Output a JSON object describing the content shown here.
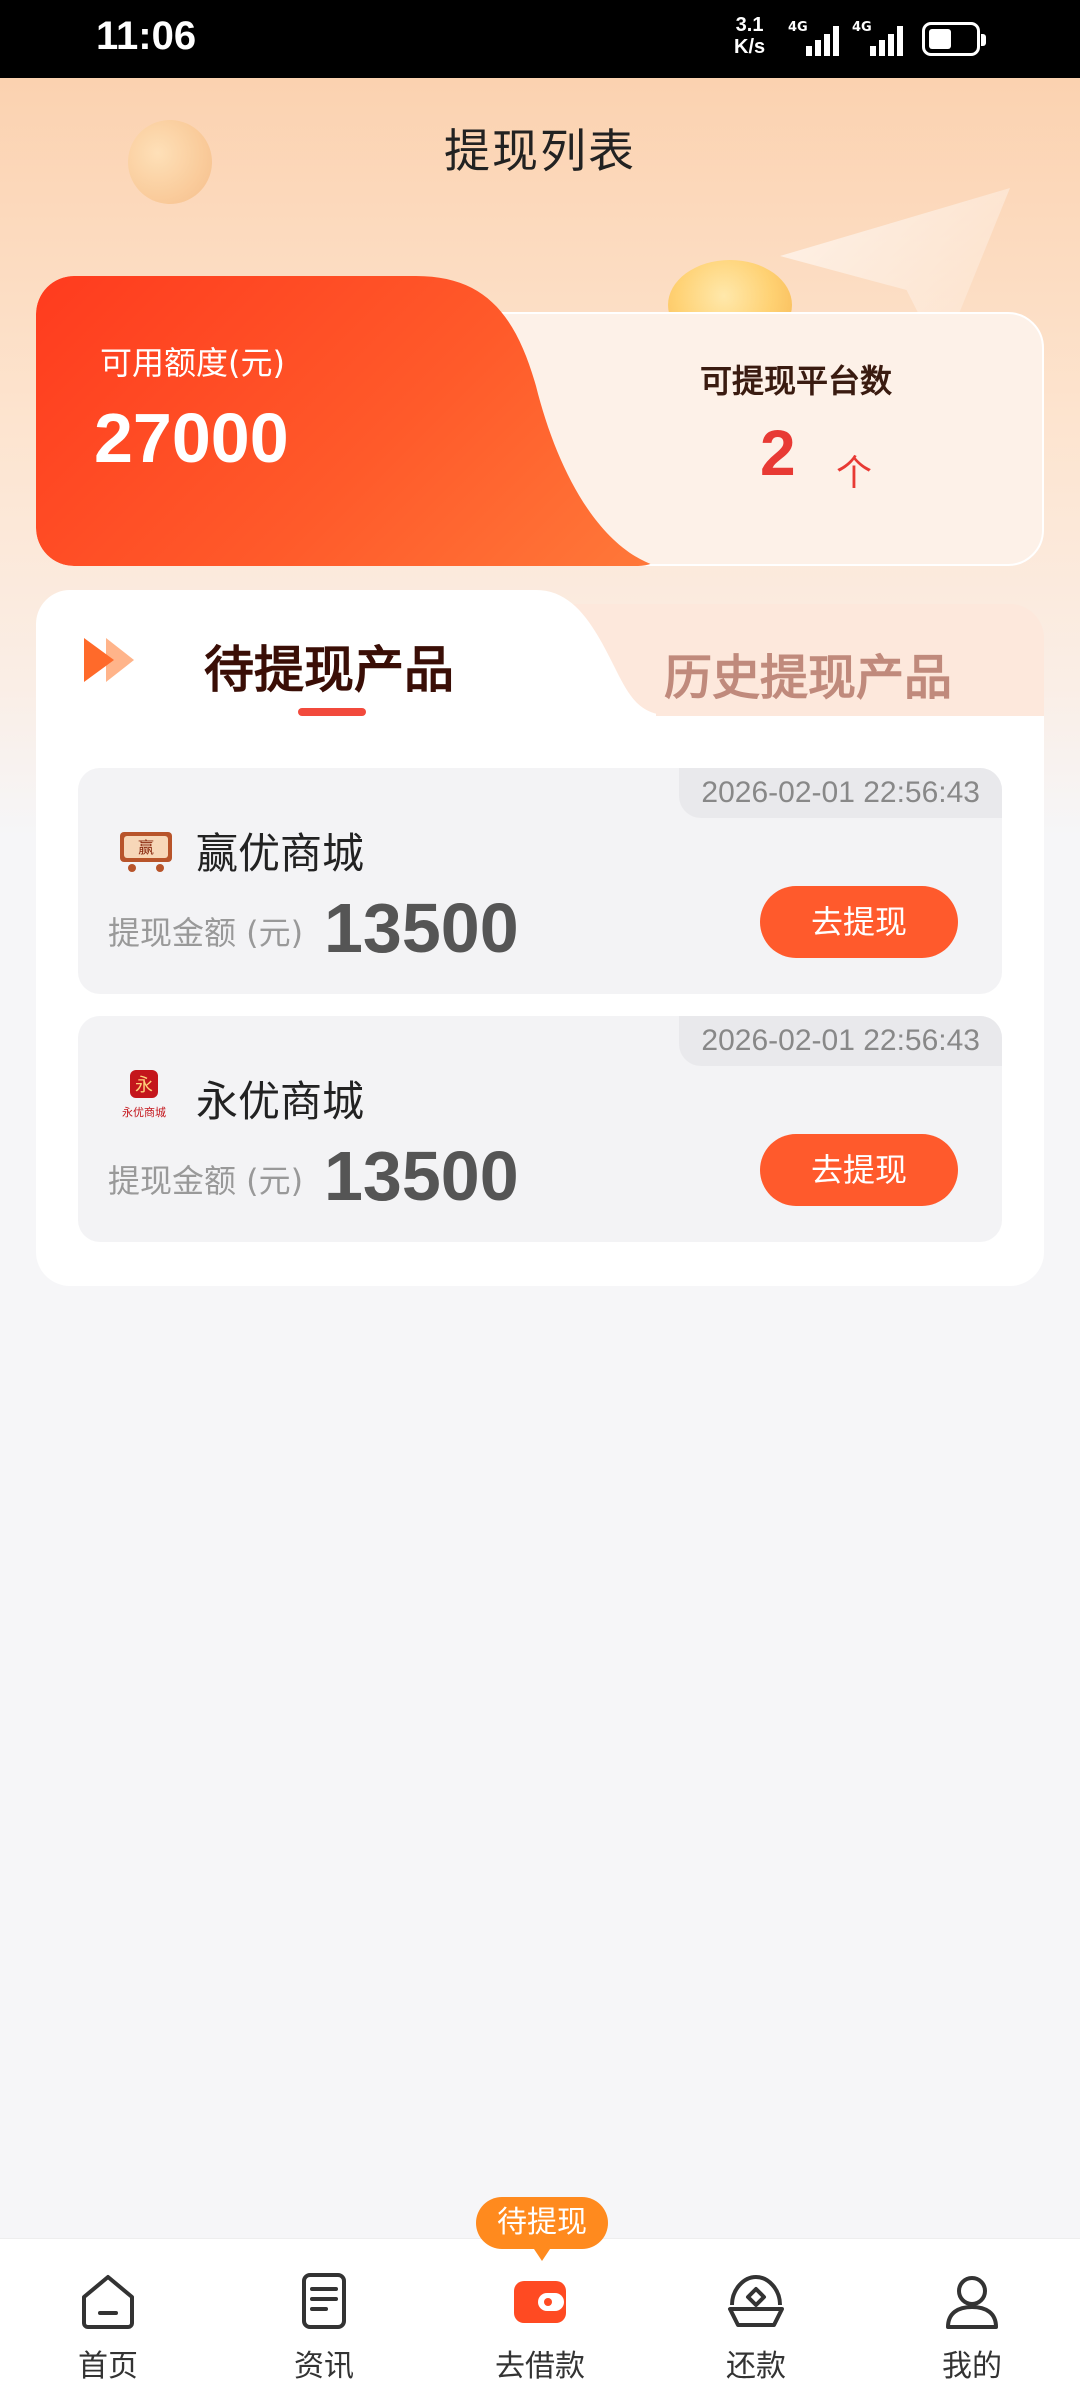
{
  "status_bar": {
    "time": "11:06",
    "speed_value": "3.1",
    "speed_unit": "K/s",
    "network1": "4G",
    "network2": "4G"
  },
  "header": {
    "title": "提现列表"
  },
  "summary": {
    "available_label": "可用额度(元)",
    "available_value": "27000",
    "platform_label": "可提现平台数",
    "platform_count": "2",
    "platform_unit": "个"
  },
  "tabs": [
    {
      "label": "待提现产品",
      "active": true
    },
    {
      "label": "历史提现产品",
      "active": false
    }
  ],
  "items": [
    {
      "timestamp": "2026-02-01 22:56:43",
      "name": "赢优商城",
      "amount_label": "提现金额 (元)",
      "amount": "13500",
      "button": "去提现",
      "logo_text": "赢"
    },
    {
      "timestamp": "2026-02-01 22:56:43",
      "name": "永优商城",
      "amount_label": "提现金额 (元)",
      "amount": "13500",
      "button": "去提现",
      "logo_text": "永",
      "logo_caption": "永优商城"
    }
  ],
  "bottom_nav": {
    "badge": "待提现",
    "items": [
      {
        "label": "首页",
        "icon": "home-icon"
      },
      {
        "label": "资讯",
        "icon": "news-icon"
      },
      {
        "label": "去借款",
        "icon": "wallet-icon",
        "active": true
      },
      {
        "label": "还款",
        "icon": "repay-icon"
      },
      {
        "label": "我的",
        "icon": "profile-icon"
      }
    ]
  },
  "colors": {
    "accent": "#ff5a2c",
    "count_red": "#e83a34",
    "badge_orange": "#ff8a1e"
  }
}
